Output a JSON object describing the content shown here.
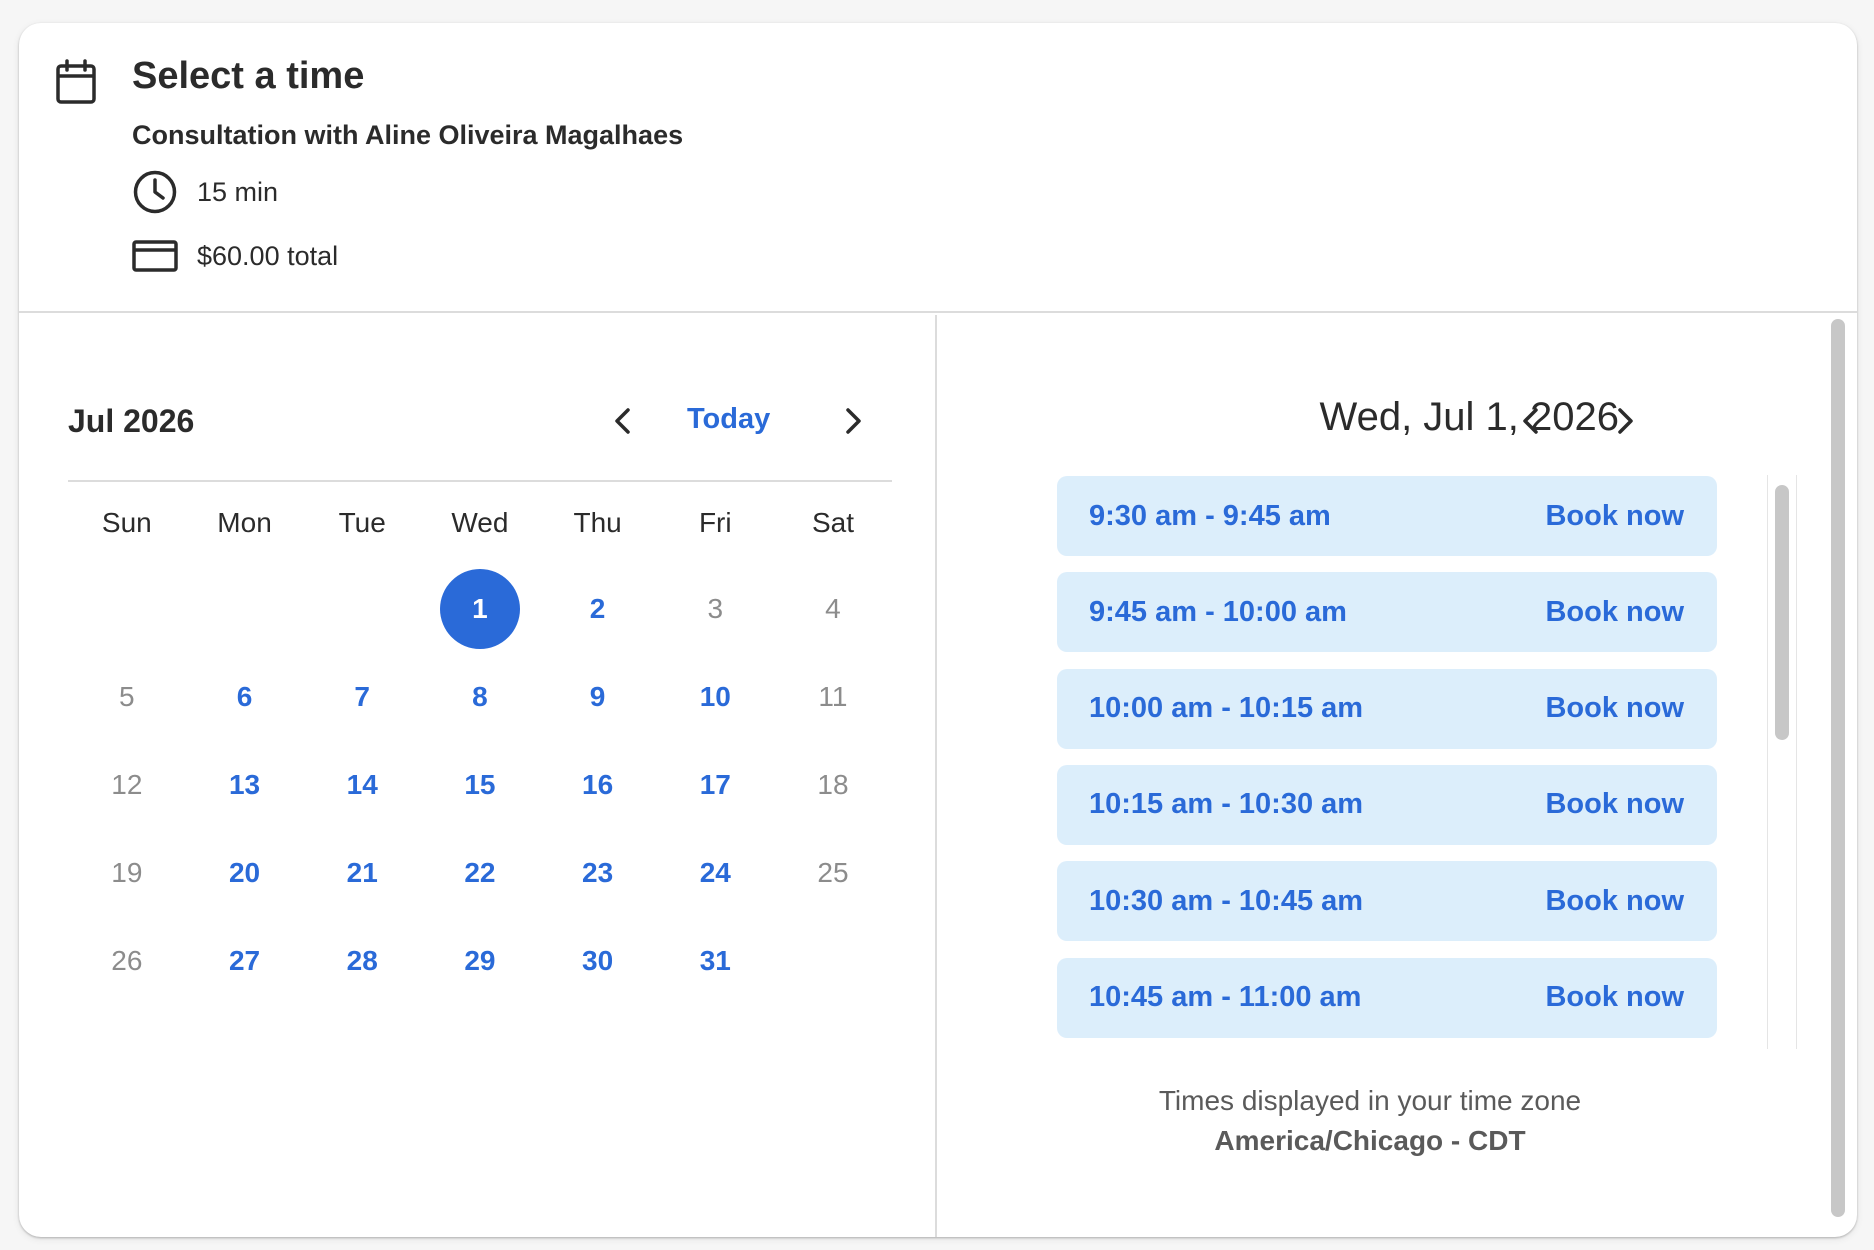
{
  "header": {
    "title": "Select a time",
    "subtitle": "Consultation with Aline Oliveira Magalhaes",
    "duration": "15 min",
    "price": "$60.00 total"
  },
  "calendar": {
    "month_label": "Jul 2026",
    "today_label": "Today",
    "weekdays": [
      "Sun",
      "Mon",
      "Tue",
      "Wed",
      "Thu",
      "Fri",
      "Sat"
    ],
    "weeks": [
      [
        {
          "d": ""
        },
        {
          "d": ""
        },
        {
          "d": ""
        },
        {
          "d": "1",
          "state": "selected"
        },
        {
          "d": "2",
          "state": "available"
        },
        {
          "d": "3",
          "state": "unavailable"
        },
        {
          "d": "4",
          "state": "unavailable"
        }
      ],
      [
        {
          "d": "5",
          "state": "unavailable"
        },
        {
          "d": "6",
          "state": "available"
        },
        {
          "d": "7",
          "state": "available"
        },
        {
          "d": "8",
          "state": "available"
        },
        {
          "d": "9",
          "state": "available"
        },
        {
          "d": "10",
          "state": "available"
        },
        {
          "d": "11",
          "state": "unavailable"
        }
      ],
      [
        {
          "d": "12",
          "state": "unavailable"
        },
        {
          "d": "13",
          "state": "available"
        },
        {
          "d": "14",
          "state": "available"
        },
        {
          "d": "15",
          "state": "available"
        },
        {
          "d": "16",
          "state": "available"
        },
        {
          "d": "17",
          "state": "available"
        },
        {
          "d": "18",
          "state": "unavailable"
        }
      ],
      [
        {
          "d": "19",
          "state": "unavailable"
        },
        {
          "d": "20",
          "state": "available"
        },
        {
          "d": "21",
          "state": "available"
        },
        {
          "d": "22",
          "state": "available"
        },
        {
          "d": "23",
          "state": "available"
        },
        {
          "d": "24",
          "state": "available"
        },
        {
          "d": "25",
          "state": "unavailable"
        }
      ],
      [
        {
          "d": "26",
          "state": "unavailable"
        },
        {
          "d": "27",
          "state": "available"
        },
        {
          "d": "28",
          "state": "available"
        },
        {
          "d": "29",
          "state": "available"
        },
        {
          "d": "30",
          "state": "available"
        },
        {
          "d": "31",
          "state": "available"
        },
        {
          "d": ""
        }
      ]
    ]
  },
  "times": {
    "date_heading": "Wed, Jul 1, 2026",
    "slots": [
      {
        "time": "9:30 am - 9:45 am",
        "action": "Book now"
      },
      {
        "time": "9:45 am - 10:00 am",
        "action": "Book now"
      },
      {
        "time": "10:00 am - 10:15 am",
        "action": "Book now"
      },
      {
        "time": "10:15 am - 10:30 am",
        "action": "Book now"
      },
      {
        "time": "10:30 am - 10:45 am",
        "action": "Book now"
      },
      {
        "time": "10:45 am - 11:00 am",
        "action": "Book now"
      }
    ],
    "tz_note": "Times displayed in your time zone",
    "tz_name": "America/Chicago - CDT"
  },
  "icons": {
    "calendar": "calendar-icon",
    "clock": "clock-icon",
    "card": "credit-card-icon",
    "prev": "chevron-left-icon",
    "next": "chevron-right-icon"
  },
  "colors": {
    "accent": "#2a6ad8",
    "slot_bg": "#dceefb",
    "muted_day": "#8c8c8c"
  }
}
